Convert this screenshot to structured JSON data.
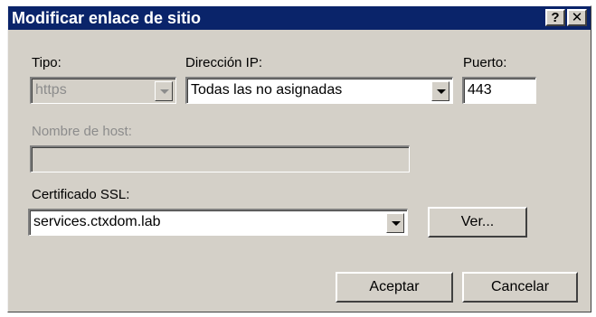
{
  "window": {
    "title": "Modificar enlace de sitio",
    "help_label": "?",
    "close_label": "✕"
  },
  "form": {
    "tipo_label": "Tipo:",
    "tipo_value": "https",
    "ip_label": "Dirección IP:",
    "ip_value": "Todas las no asignadas",
    "puerto_label": "Puerto:",
    "puerto_value": "443",
    "host_label": "Nombre de host:",
    "host_value": "",
    "ssl_label": "Certificado SSL:",
    "ssl_value": "services.ctxdom.lab"
  },
  "buttons": {
    "ver": "Ver...",
    "aceptar": "Aceptar",
    "cancelar": "Cancelar"
  }
}
